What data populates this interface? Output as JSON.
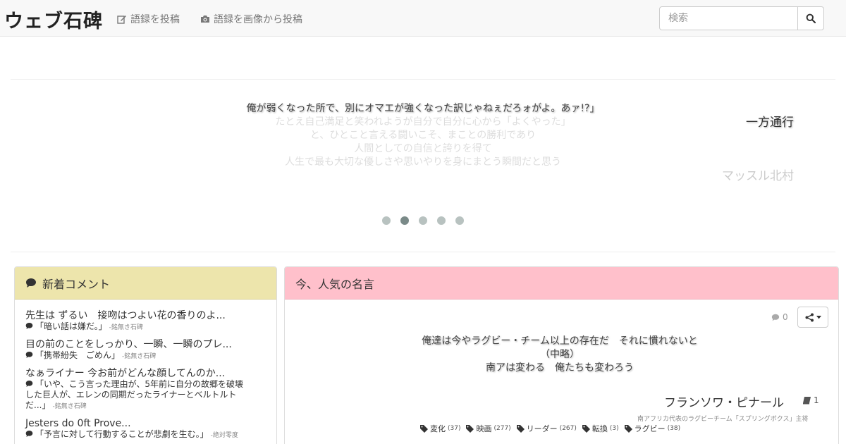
{
  "navbar": {
    "brand": "ウェブ石碑",
    "links": [
      {
        "label": "語録を投稿",
        "icon": "edit-icon"
      },
      {
        "label": "語録を画像から投稿",
        "icon": "camera-icon"
      }
    ],
    "search_placeholder": "検索"
  },
  "carousel": {
    "active_quote": "俺が弱くなった所で、別にオマエが強くなった訳じゃねぇだろォがよ。あァ!?」",
    "active_author": "一方通行",
    "next_quote_lines": [
      "たとえ自己満足と笑われようが自分で自分に心から「よくやった」",
      "と、ひとこと言える闘いこそ、まことの勝利であり",
      "人間としての自信と誇りを得て",
      "人生で最も大切な優しさや思いやりを身にまとう瞬間だと思う"
    ],
    "next_author": "マッスル北村",
    "slide_count": 5,
    "active_index": 1
  },
  "recent_comments": {
    "title": "新着コメント",
    "items": [
      {
        "quote": "先生は ずるい　接吻はつよい花の香りのよ...",
        "comment": "「暗い話は嫌だ。」",
        "author": "-銘無き石碑"
      },
      {
        "quote": "目の前のことをしっかり、一瞬、一瞬のプレ...",
        "comment": "「携帯紛失　ごめん」",
        "author": "-銘無き石碑"
      },
      {
        "quote": "なぁライナー 今お前がどんな顔してんのか...",
        "comment_lines": [
          "「いや、こう言った理由が、5年前に自分の故郷を破壊",
          "した巨人が、エレンの同期だったライナーとベルトルト",
          "だ...」"
        ],
        "author": "-銘無き石碑"
      },
      {
        "quote": "Jesters do 0ft Prove...",
        "comment": "「予言に対して行動することが悲劇を生む。」",
        "author": "-絶対零度"
      }
    ]
  },
  "popular": {
    "title": "今、人気の名言",
    "comment_count": "0",
    "quote_lines": [
      "俺達は今やラグビー・チーム以上の存在だ　それに慣れないと",
      "（中略）",
      "南アは変わる　俺たちも変わろう"
    ],
    "author": "フランソワ・ピナール",
    "source_count": "1",
    "description": "南アフリカ代表のラグビーチーム「スプリングボクス」主将",
    "tags": [
      {
        "name": "変化",
        "count": "(37)"
      },
      {
        "name": "映画",
        "count": "(277)"
      },
      {
        "name": "リーダー",
        "count": "(267)"
      },
      {
        "name": "転換",
        "count": "(3)"
      },
      {
        "name": "ラグビー",
        "count": "(38)"
      }
    ]
  },
  "colors": {
    "comments_header": "#ede5ac",
    "popular_header": "#ffc0cb"
  }
}
